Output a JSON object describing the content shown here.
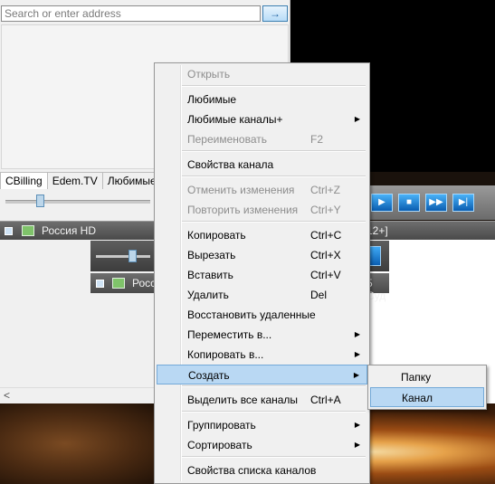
{
  "address_bar": {
    "placeholder": "Search or enter address",
    "go_icon": "arrow-right-icon"
  },
  "tabs": [
    "CBilling",
    "Edem.TV",
    "Любимые"
  ],
  "player_bar": {
    "channel": "Россия HD",
    "right_text": "12+]"
  },
  "player2_bar": {
    "channel": "Росс",
    "right_text": "5 Суд"
  },
  "scroll": {
    "left_arrow": "<"
  },
  "context_menu": {
    "items": [
      {
        "label": "Открыть",
        "shortcut": "",
        "submenu": false,
        "disabled": true
      },
      {
        "label": "Любимые",
        "shortcut": "",
        "submenu": false,
        "disabled": false
      },
      {
        "label": "Любимые каналы+",
        "shortcut": "",
        "submenu": true,
        "disabled": false
      },
      {
        "label": "Переименовать",
        "shortcut": "F2",
        "submenu": false,
        "disabled": true
      },
      {
        "label": "Свойства канала",
        "shortcut": "",
        "submenu": false,
        "disabled": false
      },
      {
        "label": "Отменить изменения",
        "shortcut": "Ctrl+Z",
        "submenu": false,
        "disabled": true
      },
      {
        "label": "Повторить изменения",
        "shortcut": "Ctrl+Y",
        "submenu": false,
        "disabled": true
      },
      {
        "label": "Копировать",
        "shortcut": "Ctrl+C",
        "submenu": false,
        "disabled": false
      },
      {
        "label": "Вырезать",
        "shortcut": "Ctrl+X",
        "submenu": false,
        "disabled": false
      },
      {
        "label": "Вставить",
        "shortcut": "Ctrl+V",
        "submenu": false,
        "disabled": false
      },
      {
        "label": "Удалить",
        "shortcut": "Del",
        "submenu": false,
        "disabled": false
      },
      {
        "label": "Восстановить удаленные",
        "shortcut": "",
        "submenu": false,
        "disabled": false
      },
      {
        "label": "Переместить в...",
        "shortcut": "",
        "submenu": true,
        "disabled": false
      },
      {
        "label": "Копировать в...",
        "shortcut": "",
        "submenu": true,
        "disabled": false
      },
      {
        "label": "Создать",
        "shortcut": "",
        "submenu": true,
        "disabled": false,
        "highlighted": true
      },
      {
        "label": "Выделить все каналы",
        "shortcut": "Ctrl+A",
        "submenu": false,
        "disabled": false
      },
      {
        "label": "Группировать",
        "shortcut": "",
        "submenu": true,
        "disabled": false
      },
      {
        "label": "Сортировать",
        "shortcut": "",
        "submenu": true,
        "disabled": false
      },
      {
        "label": "Свойства списка каналов",
        "shortcut": "",
        "submenu": false,
        "disabled": false
      }
    ]
  },
  "create_submenu": {
    "items": [
      {
        "label": "Папку",
        "highlighted": false
      },
      {
        "label": "Канал",
        "highlighted": true
      }
    ]
  },
  "colors": {
    "highlight": "#b9d8f3",
    "highlight_border": "#73a9d8",
    "menu_bg": "#f0f0f0"
  }
}
